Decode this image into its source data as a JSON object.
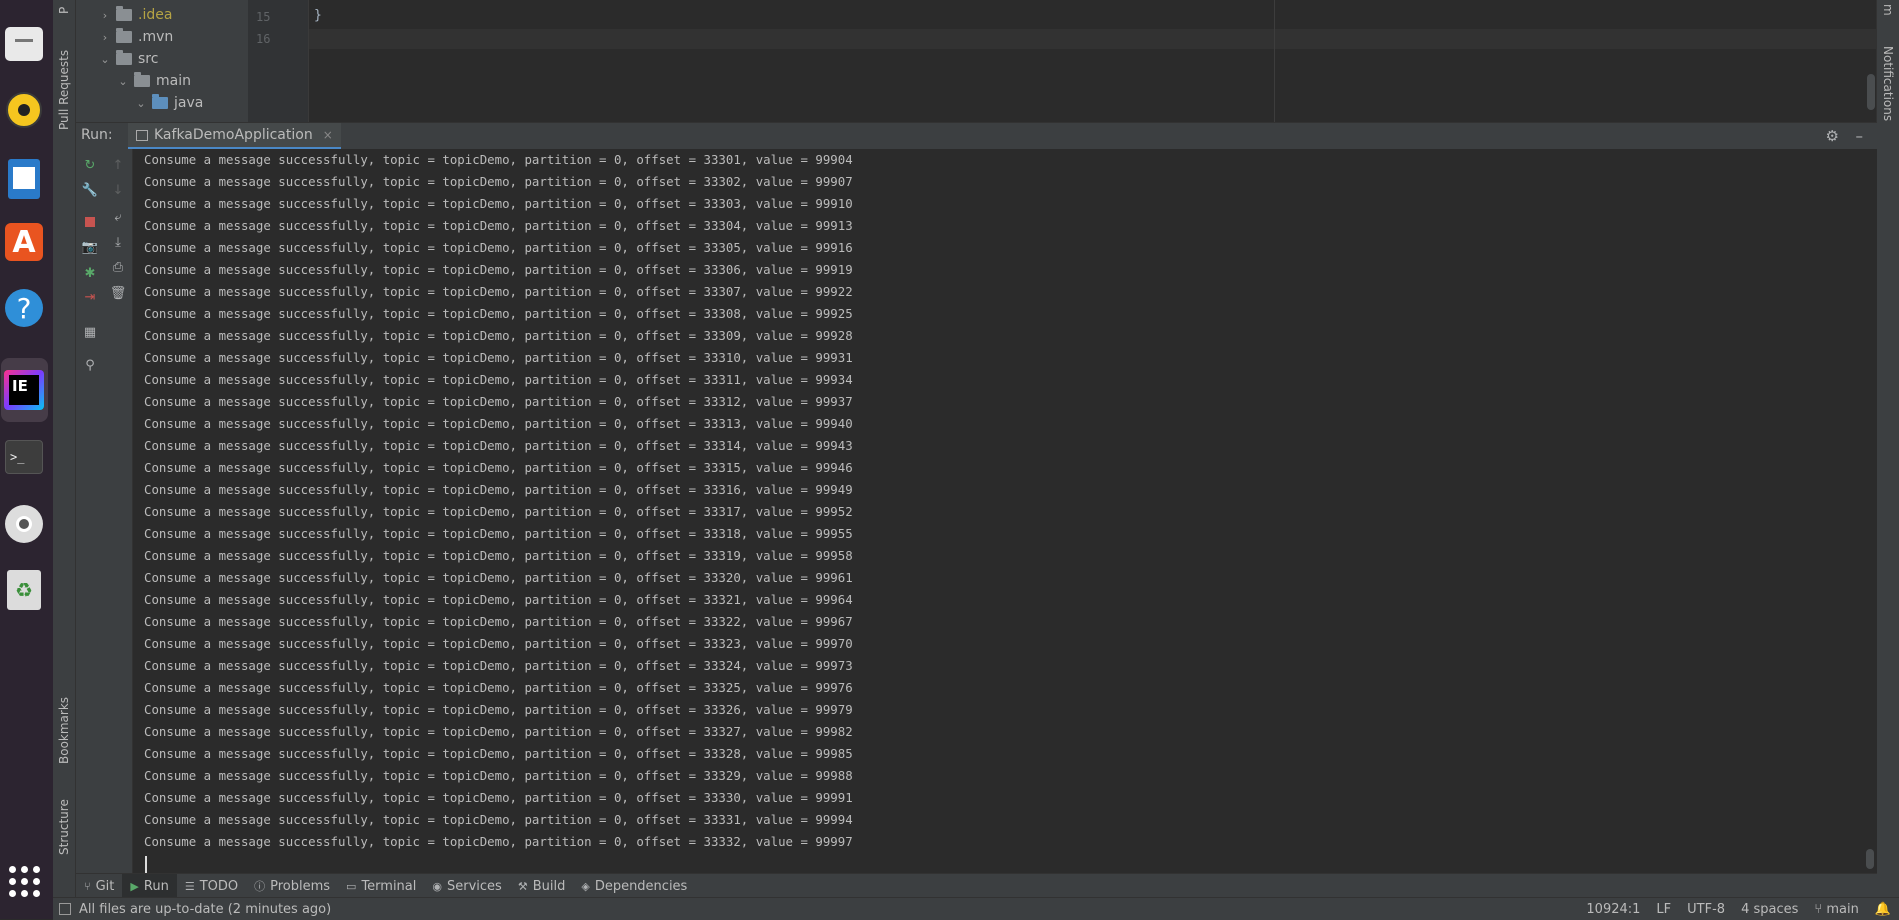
{
  "dock": {
    "items": [
      "files",
      "rhythmbox",
      "writer",
      "software",
      "help",
      "intellij",
      "terminal",
      "disc",
      "trash",
      "apps"
    ],
    "intellij_label": "IE",
    "terminal_label": ">_",
    "help_label": "?",
    "store_label": "A",
    "trash_label": "♻"
  },
  "left_strip": {
    "top_tab": "P",
    "pull_requests": "Pull Requests",
    "bookmarks": "Bookmarks",
    "structure": "Structure"
  },
  "right_strip": {
    "top_tab": "m",
    "notifications": "Notifications"
  },
  "project_tree": [
    {
      "label": ".idea",
      "color": "#b5a344"
    },
    {
      "label": ".mvn",
      "color": "#bbbbbb"
    },
    {
      "label": "src",
      "color": "#bbbbbb"
    },
    {
      "label": "main",
      "color": "#bbbbbb"
    },
    {
      "label": "java",
      "color": "#bbbbbb"
    }
  ],
  "editor": {
    "lines": [
      {
        "num": "15",
        "code": "}"
      },
      {
        "num": "16",
        "code": ""
      }
    ]
  },
  "run_panel": {
    "label": "Run:",
    "tab_title": "KafkaDemoApplication",
    "tab_close": "×",
    "settings_icon": "⚙",
    "minimize_icon": "–"
  },
  "console": {
    "lines": [
      "Consume a message successfully, topic = topicDemo, partition = 0, offset = 33301, value = 99904",
      "Consume a message successfully, topic = topicDemo, partition = 0, offset = 33302, value = 99907",
      "Consume a message successfully, topic = topicDemo, partition = 0, offset = 33303, value = 99910",
      "Consume a message successfully, topic = topicDemo, partition = 0, offset = 33304, value = 99913",
      "Consume a message successfully, topic = topicDemo, partition = 0, offset = 33305, value = 99916",
      "Consume a message successfully, topic = topicDemo, partition = 0, offset = 33306, value = 99919",
      "Consume a message successfully, topic = topicDemo, partition = 0, offset = 33307, value = 99922",
      "Consume a message successfully, topic = topicDemo, partition = 0, offset = 33308, value = 99925",
      "Consume a message successfully, topic = topicDemo, partition = 0, offset = 33309, value = 99928",
      "Consume a message successfully, topic = topicDemo, partition = 0, offset = 33310, value = 99931",
      "Consume a message successfully, topic = topicDemo, partition = 0, offset = 33311, value = 99934",
      "Consume a message successfully, topic = topicDemo, partition = 0, offset = 33312, value = 99937",
      "Consume a message successfully, topic = topicDemo, partition = 0, offset = 33313, value = 99940",
      "Consume a message successfully, topic = topicDemo, partition = 0, offset = 33314, value = 99943",
      "Consume a message successfully, topic = topicDemo, partition = 0, offset = 33315, value = 99946",
      "Consume a message successfully, topic = topicDemo, partition = 0, offset = 33316, value = 99949",
      "Consume a message successfully, topic = topicDemo, partition = 0, offset = 33317, value = 99952",
      "Consume a message successfully, topic = topicDemo, partition = 0, offset = 33318, value = 99955",
      "Consume a message successfully, topic = topicDemo, partition = 0, offset = 33319, value = 99958",
      "Consume a message successfully, topic = topicDemo, partition = 0, offset = 33320, value = 99961",
      "Consume a message successfully, topic = topicDemo, partition = 0, offset = 33321, value = 99964",
      "Consume a message successfully, topic = topicDemo, partition = 0, offset = 33322, value = 99967",
      "Consume a message successfully, topic = topicDemo, partition = 0, offset = 33323, value = 99970",
      "Consume a message successfully, topic = topicDemo, partition = 0, offset = 33324, value = 99973",
      "Consume a message successfully, topic = topicDemo, partition = 0, offset = 33325, value = 99976",
      "Consume a message successfully, topic = topicDemo, partition = 0, offset = 33326, value = 99979",
      "Consume a message successfully, topic = topicDemo, partition = 0, offset = 33327, value = 99982",
      "Consume a message successfully, topic = topicDemo, partition = 0, offset = 33328, value = 99985",
      "Consume a message successfully, topic = topicDemo, partition = 0, offset = 33329, value = 99988",
      "Consume a message successfully, topic = topicDemo, partition = 0, offset = 33330, value = 99991",
      "Consume a message successfully, topic = topicDemo, partition = 0, offset = 33331, value = 99994",
      "Consume a message successfully, topic = topicDemo, partition = 0, offset = 33332, value = 99997"
    ]
  },
  "run_toolbar": {
    "column1": [
      "rerun-icon",
      "wrench-icon",
      "stop-icon",
      "camera-icon",
      "debug-icon",
      "exit-icon",
      "layout-icon",
      "pin-icon"
    ],
    "column2": [
      "arrow-up-icon",
      "arrow-down-icon",
      "soft-wrap-icon",
      "scroll-to-end-icon",
      "print-icon",
      "clear-icon"
    ]
  },
  "bottom_tabs": [
    {
      "icon": "git-icon",
      "label": "Git"
    },
    {
      "icon": "run-icon",
      "label": "Run",
      "active": true
    },
    {
      "icon": "todo-icon",
      "label": "TODO"
    },
    {
      "icon": "problems-icon",
      "label": "Problems"
    },
    {
      "icon": "terminal-icon",
      "label": "Terminal"
    },
    {
      "icon": "services-icon",
      "label": "Services"
    },
    {
      "icon": "build-icon",
      "label": "Build"
    },
    {
      "icon": "dependencies-icon",
      "label": "Dependencies"
    }
  ],
  "statusbar": {
    "message": "All files are up-to-date (2 minutes ago)",
    "position": "10924:1",
    "line_sep": "LF",
    "encoding": "UTF-8",
    "indent": "4 spaces",
    "branch": "main"
  },
  "colors": {
    "accent_tab": "#4a88c7",
    "rerun_green": "#59a869",
    "stop_red": "#c75450"
  }
}
